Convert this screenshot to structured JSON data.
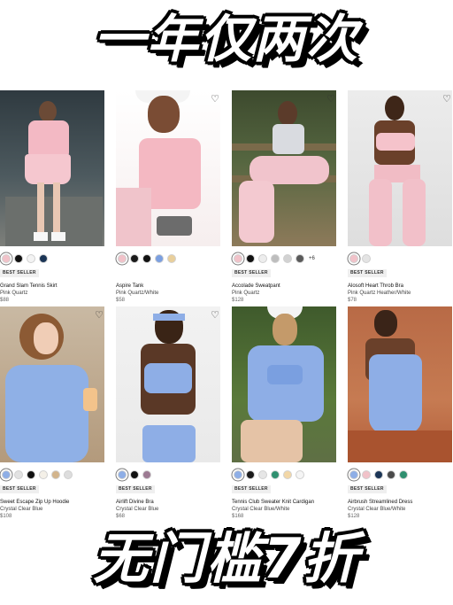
{
  "banner_top": "一年仅两次",
  "banner_bottom": "无门槛7折",
  "badge_label": "BEST SELLER",
  "products": [
    {
      "name": "Grand Slam Tennis Skirt",
      "color": "Pink Quartz",
      "price": "$88",
      "swatches": [
        "#f1c2c9",
        "#111111",
        "#f3f3f3",
        "#1b3556"
      ],
      "selected": 0,
      "more": "",
      "wishlist": false
    },
    {
      "name": "Aspire Tank",
      "color": "Pink Quartz/White",
      "price": "$58",
      "swatches": [
        "#f1c2c9",
        "#1a1a1a",
        "#111111",
        "#7b9fe0",
        "#e9cf9b"
      ],
      "selected": 0,
      "more": "",
      "wishlist": true
    },
    {
      "name": "Accolade Sweatpant",
      "color": "Pink Quartz",
      "price": "$128",
      "swatches": [
        "#f1c2c9",
        "#111111",
        "#ededed",
        "#bdbdbd",
        "#d2d2d2",
        "#5a5a5a"
      ],
      "selected": 0,
      "more": "+6",
      "wishlist": true
    },
    {
      "name": "Alosoft Heart Throb Bra",
      "color": "Pink Quartz Heather/White",
      "price": "$78",
      "swatches": [
        "#f1c2c9",
        "#e4e4e4"
      ],
      "selected": 0,
      "more": "",
      "wishlist": true
    },
    {
      "name": "Sweet Escape Zip Up Hoodie",
      "color": "Crystal Clear Blue",
      "price": "$108",
      "swatches": [
        "#8eaee6",
        "#e2e2e2",
        "#111111",
        "#f4f0e8",
        "#d2b48c",
        "#dddddd"
      ],
      "selected": 0,
      "more": "",
      "wishlist": true
    },
    {
      "name": "Airlift Divine Bra",
      "color": "Crystal Clear Blue",
      "price": "$68",
      "swatches": [
        "#8eaee6",
        "#111111",
        "#9c7a92"
      ],
      "selected": 0,
      "more": "",
      "wishlist": true
    },
    {
      "name": "Tennis Club Sweater Knit Cardigan",
      "color": "Crystal Clear Blue/White",
      "price": "$168",
      "swatches": [
        "#8eaee6",
        "#1a1a1a",
        "#e6e6e6",
        "#2f8f6f",
        "#f2d7a7",
        "#f5f5f5"
      ],
      "selected": 0,
      "more": "",
      "wishlist": false
    },
    {
      "name": "Airbrush Streamlined Dress",
      "color": "Crystal Clear Blue/White",
      "price": "$128",
      "swatches": [
        "#8eaee6",
        "#f1c2c9",
        "#1b3556",
        "#4a4a4a",
        "#2f8f6f"
      ],
      "selected": 0,
      "more": "",
      "wishlist": false
    }
  ]
}
